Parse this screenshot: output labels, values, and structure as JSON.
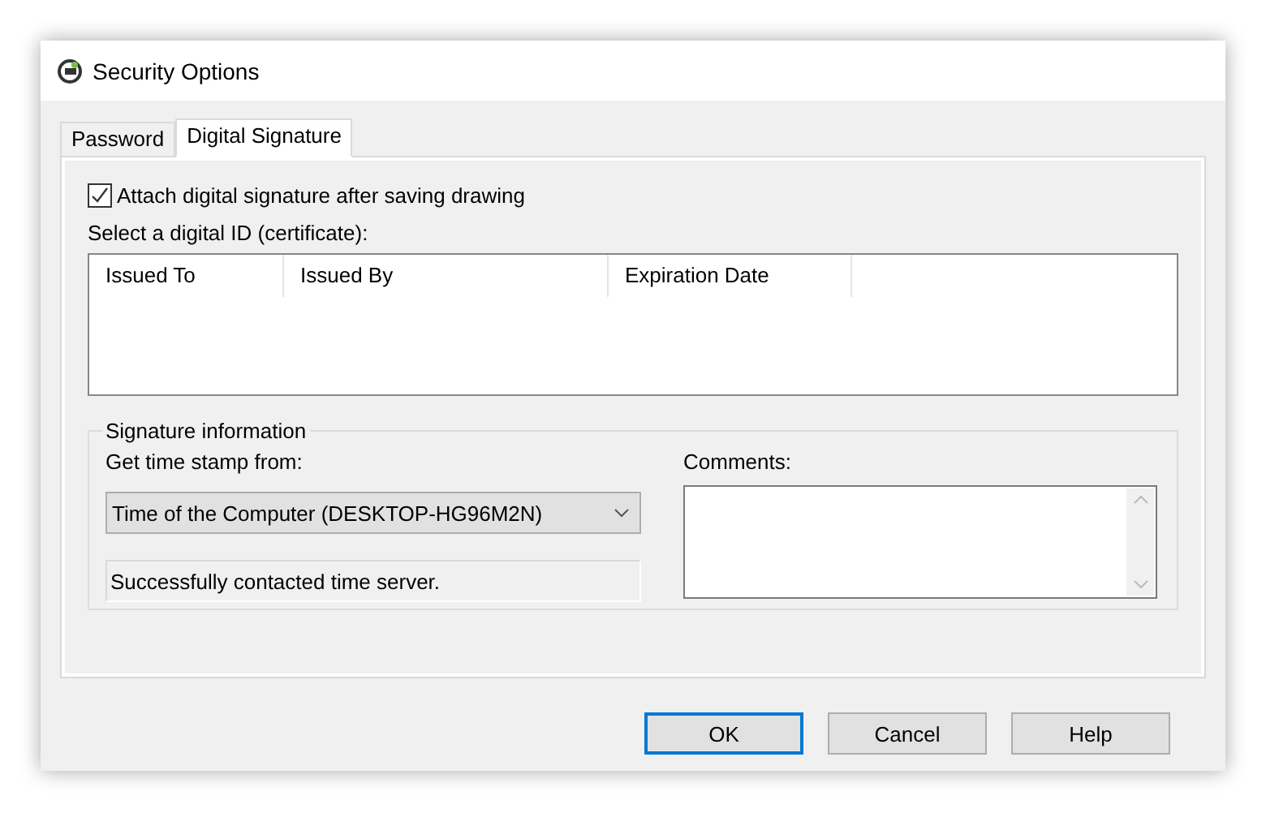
{
  "window": {
    "title": "Security Options"
  },
  "tabs": [
    {
      "label": "Password",
      "selected": false
    },
    {
      "label": "Digital Signature",
      "selected": true
    }
  ],
  "attach_signature": {
    "label": "Attach digital signature after saving drawing",
    "checked": true
  },
  "certificate_list": {
    "label": "Select a digital ID (certificate):",
    "columns": [
      "Issued To",
      "Issued By",
      "Expiration Date"
    ]
  },
  "signature_information": {
    "title": "Signature information",
    "time_stamp_label": "Get time stamp from:",
    "time_stamp_value": "Time of the Computer (DESKTOP-HG96M2N)",
    "status": "Successfully contacted time server.",
    "comments_label": "Comments:"
  },
  "buttons": [
    {
      "label": "OK",
      "default": true
    },
    {
      "label": "Cancel",
      "default": false
    },
    {
      "label": "Help",
      "default": false
    }
  ]
}
